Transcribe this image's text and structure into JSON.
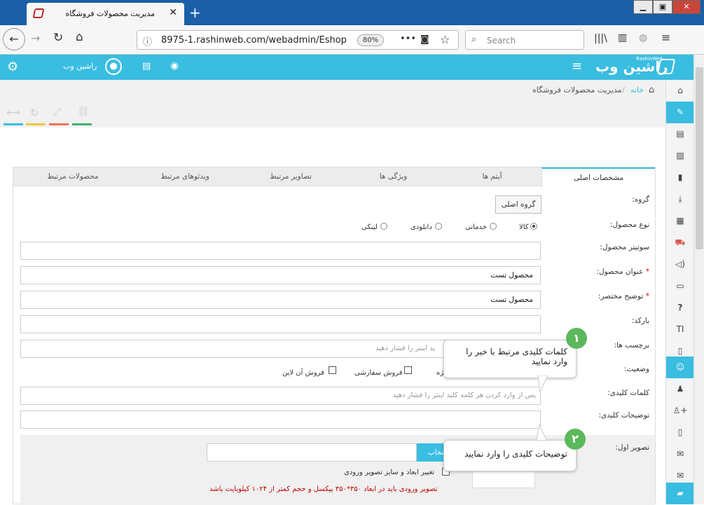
{
  "browser": {
    "tab_title": "مدیریت محصولات فروشگاه",
    "url": "8975-1.rashinweb.com/webadmin/Eshop",
    "zoom": "80%",
    "search_placeholder": "Search"
  },
  "app": {
    "user_name": "راشین وب",
    "logo": "راشین وب",
    "logo_sub": "RashinWeb"
  },
  "breadcrumb": {
    "home": "خانه",
    "current": "مدیریت محصولات فروشگاه"
  },
  "tabs": [
    "مشخصات اصلی",
    "آیتم ها",
    "ویژگی ها",
    "تصاویر مرتبط",
    "ویدئوهای مرتبط",
    "محصولات مرتبط"
  ],
  "form": {
    "group_label": "گروه:",
    "group_button": "گروه اصلی",
    "type_label": "نوع محصول:",
    "type_options": [
      "کالا",
      "خدماتی",
      "دانلودی",
      "لینکی"
    ],
    "subtitle_label": "سوتیتر محصول:",
    "title_label": "عنوان محصول:",
    "title_value": "محصول تست",
    "short_desc_label": "توضیح مختصر:",
    "short_desc_value": "محصول تست",
    "barcode_label": "بارکد:",
    "tags_label": "برچسب ها:",
    "tags_placeholder": "ید اینتر را فشار دهید",
    "status_label": "وضعیت:",
    "status_options": [
      "فروش آن لاین",
      "فروش سفارشی",
      "ویژه"
    ],
    "keywords_label": "کلمات کلیدی:",
    "keywords_placeholder": "پس از وارد کردن هر کلمه کلید اینتر را فشار دهید",
    "keydesc_label": "توضیحات کلیدی:",
    "image_label": "تصویر اول:",
    "image_button": "انتخاب",
    "resize_label": "تغییر ابعاد و سایز تصویر ورودی",
    "image_note": "تصویر ورودی باید در ابعاد ۳۵۰*۳۵۰ پیکسل و حجم کمتر از ۱۰۲۴ کیلوبایت باشد",
    "required_mark": "*"
  },
  "callouts": [
    {
      "number": "۱",
      "text": "کلمات کلیدی مرتبط با خبر را وارد نمایید"
    },
    {
      "number": "۲",
      "text": "توضیحات کلیدی را وارد نمایید"
    }
  ],
  "colors": {
    "accent": "#39bde0",
    "tabbar": "#1a5fa7",
    "badge": "#5cb85c",
    "note": "#c00000"
  }
}
